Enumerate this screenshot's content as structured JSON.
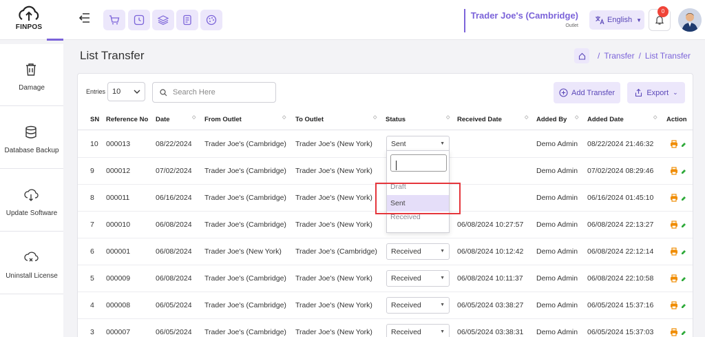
{
  "app": {
    "logo_text": "FINPOS",
    "store_name": "Trader Joe's (Cambridge)",
    "store_type": "Outlet",
    "language": "English",
    "notification_count": "0"
  },
  "toolbar_icons": [
    "cart-icon",
    "clock-icon",
    "layers-icon",
    "receipt-icon",
    "palette-icon"
  ],
  "sidebar": {
    "items": [
      {
        "label": "Damage",
        "icon": "trash-icon"
      },
      {
        "label": "Database Backup",
        "icon": "database-icon"
      },
      {
        "label": "Update Software",
        "icon": "cloud-download-icon"
      },
      {
        "label": "Uninstall License",
        "icon": "cloud-remove-icon"
      }
    ]
  },
  "page": {
    "title": "List Transfer",
    "breadcrumb": [
      "Transfer",
      "List Transfer"
    ]
  },
  "controls": {
    "entries_label": "Entries",
    "entries_value": "10",
    "search_placeholder": "Search Here",
    "add_label": "Add Transfer",
    "export_label": "Export"
  },
  "table": {
    "headers": {
      "sn": "SN",
      "ref": "Reference No",
      "date": "Date",
      "from": "From Outlet",
      "to": "To Outlet",
      "status": "Status",
      "received": "Received Date",
      "added_by": "Added By",
      "added_date": "Added Date",
      "action": "Action"
    },
    "rows": [
      {
        "sn": "10",
        "ref": "000013",
        "date": "08/22/2024",
        "from": "Trader Joe's (Cambridge)",
        "to": "Trader Joe's (New York)",
        "status": "Sent",
        "received": "",
        "added_by": "Demo Admin",
        "added_date": "08/22/2024 21:46:32"
      },
      {
        "sn": "9",
        "ref": "000012",
        "date": "07/02/2024",
        "from": "Trader Joe's (Cambridge)",
        "to": "Trader Joe's (New York)",
        "status": "",
        "received": "",
        "added_by": "Demo Admin",
        "added_date": "07/02/2024 08:29:46"
      },
      {
        "sn": "8",
        "ref": "000011",
        "date": "06/16/2024",
        "from": "Trader Joe's (Cambridge)",
        "to": "Trader Joe's (New York)",
        "status": "",
        "received": "",
        "added_by": "Demo Admin",
        "added_date": "06/16/2024 01:45:10"
      },
      {
        "sn": "7",
        "ref": "000010",
        "date": "06/08/2024",
        "from": "Trader Joe's (Cambridge)",
        "to": "Trader Joe's (New York)",
        "status": "Received",
        "received": "06/08/2024 10:27:57",
        "added_by": "Demo Admin",
        "added_date": "06/08/2024 22:13:27"
      },
      {
        "sn": "6",
        "ref": "000001",
        "date": "06/08/2024",
        "from": "Trader Joe's (New York)",
        "to": "Trader Joe's (Cambridge)",
        "status": "Received",
        "received": "06/08/2024 10:12:42",
        "added_by": "Demo Admin",
        "added_date": "06/08/2024 22:12:14"
      },
      {
        "sn": "5",
        "ref": "000009",
        "date": "06/08/2024",
        "from": "Trader Joe's (Cambridge)",
        "to": "Trader Joe's (New York)",
        "status": "Received",
        "received": "06/08/2024 10:11:37",
        "added_by": "Demo Admin",
        "added_date": "06/08/2024 22:10:58"
      },
      {
        "sn": "4",
        "ref": "000008",
        "date": "06/05/2024",
        "from": "Trader Joe's (Cambridge)",
        "to": "Trader Joe's (New York)",
        "status": "Received",
        "received": "06/05/2024 03:38:27",
        "added_by": "Demo Admin",
        "added_date": "06/05/2024 15:37:16"
      },
      {
        "sn": "3",
        "ref": "000007",
        "date": "06/05/2024",
        "from": "Trader Joe's (Cambridge)",
        "to": "Trader Joe's (New York)",
        "status": "Received",
        "received": "06/05/2024 03:38:31",
        "added_by": "Demo Admin",
        "added_date": "06/05/2024 15:37:03"
      }
    ]
  },
  "status_dropdown": {
    "search_value": "",
    "options": [
      "Draft",
      "Sent",
      "Received"
    ],
    "selected": "Sent"
  },
  "colors": {
    "accent": "#7b63d9",
    "accent_light": "#ece7fb",
    "highlight_box": "#e5353b",
    "print_icon": "#f08c00",
    "edit_icon": "#2eaa3a"
  }
}
